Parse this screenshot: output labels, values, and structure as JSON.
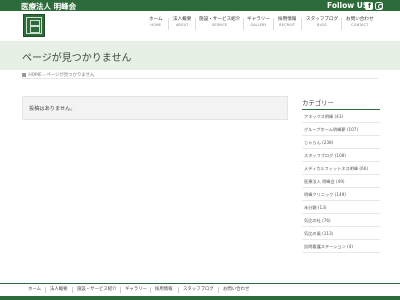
{
  "topbar": {
    "org": "医療法人 明峰会",
    "follow": "Follow US!",
    "facebook_icon": "facebook-icon",
    "instagram_icon": "instagram-icon"
  },
  "colors": {
    "brand": "#2e6b3a",
    "title_bg": "#e6f0e4"
  },
  "nav": [
    {
      "jp": "ホーム",
      "en": "HOME"
    },
    {
      "jp": "法人概要",
      "en": "ABOUT"
    },
    {
      "jp": "施設・サービス紹介",
      "en": "SERVICE"
    },
    {
      "jp": "ギャラリー",
      "en": "GALLERY"
    },
    {
      "jp": "採用情報",
      "en": "RECRUIT"
    },
    {
      "jp": "スタッフブログ",
      "en": "BLOG"
    },
    {
      "jp": "お問い合わせ",
      "en": "CONTACT"
    }
  ],
  "page_title": "ページが見つかりません",
  "breadcrumb": {
    "home": "HOME",
    "current": "ページが見つかりません"
  },
  "notice": "投稿はありません。",
  "sidebar": {
    "heading": "カテゴリー",
    "categories": [
      "アネックス明峰 (43)",
      "グループホーム明峰夢 (107)",
      "じゃらん (238)",
      "スタッフブログ (108)",
      "メディカルフィットネス明峰 (66)",
      "医療法人 明峰会 (49)",
      "明峰クリニック (149)",
      "未分類 (13)",
      "気比の杜 (76)",
      "気比の風 (113)",
      "訪問看護ステーション (4)"
    ]
  },
  "footer_nav": [
    "ホーム",
    "法人概要",
    "施設・サービス紹介",
    "ギャラリー",
    "採用情報",
    "スタッフブログ",
    "お問い合わせ"
  ]
}
